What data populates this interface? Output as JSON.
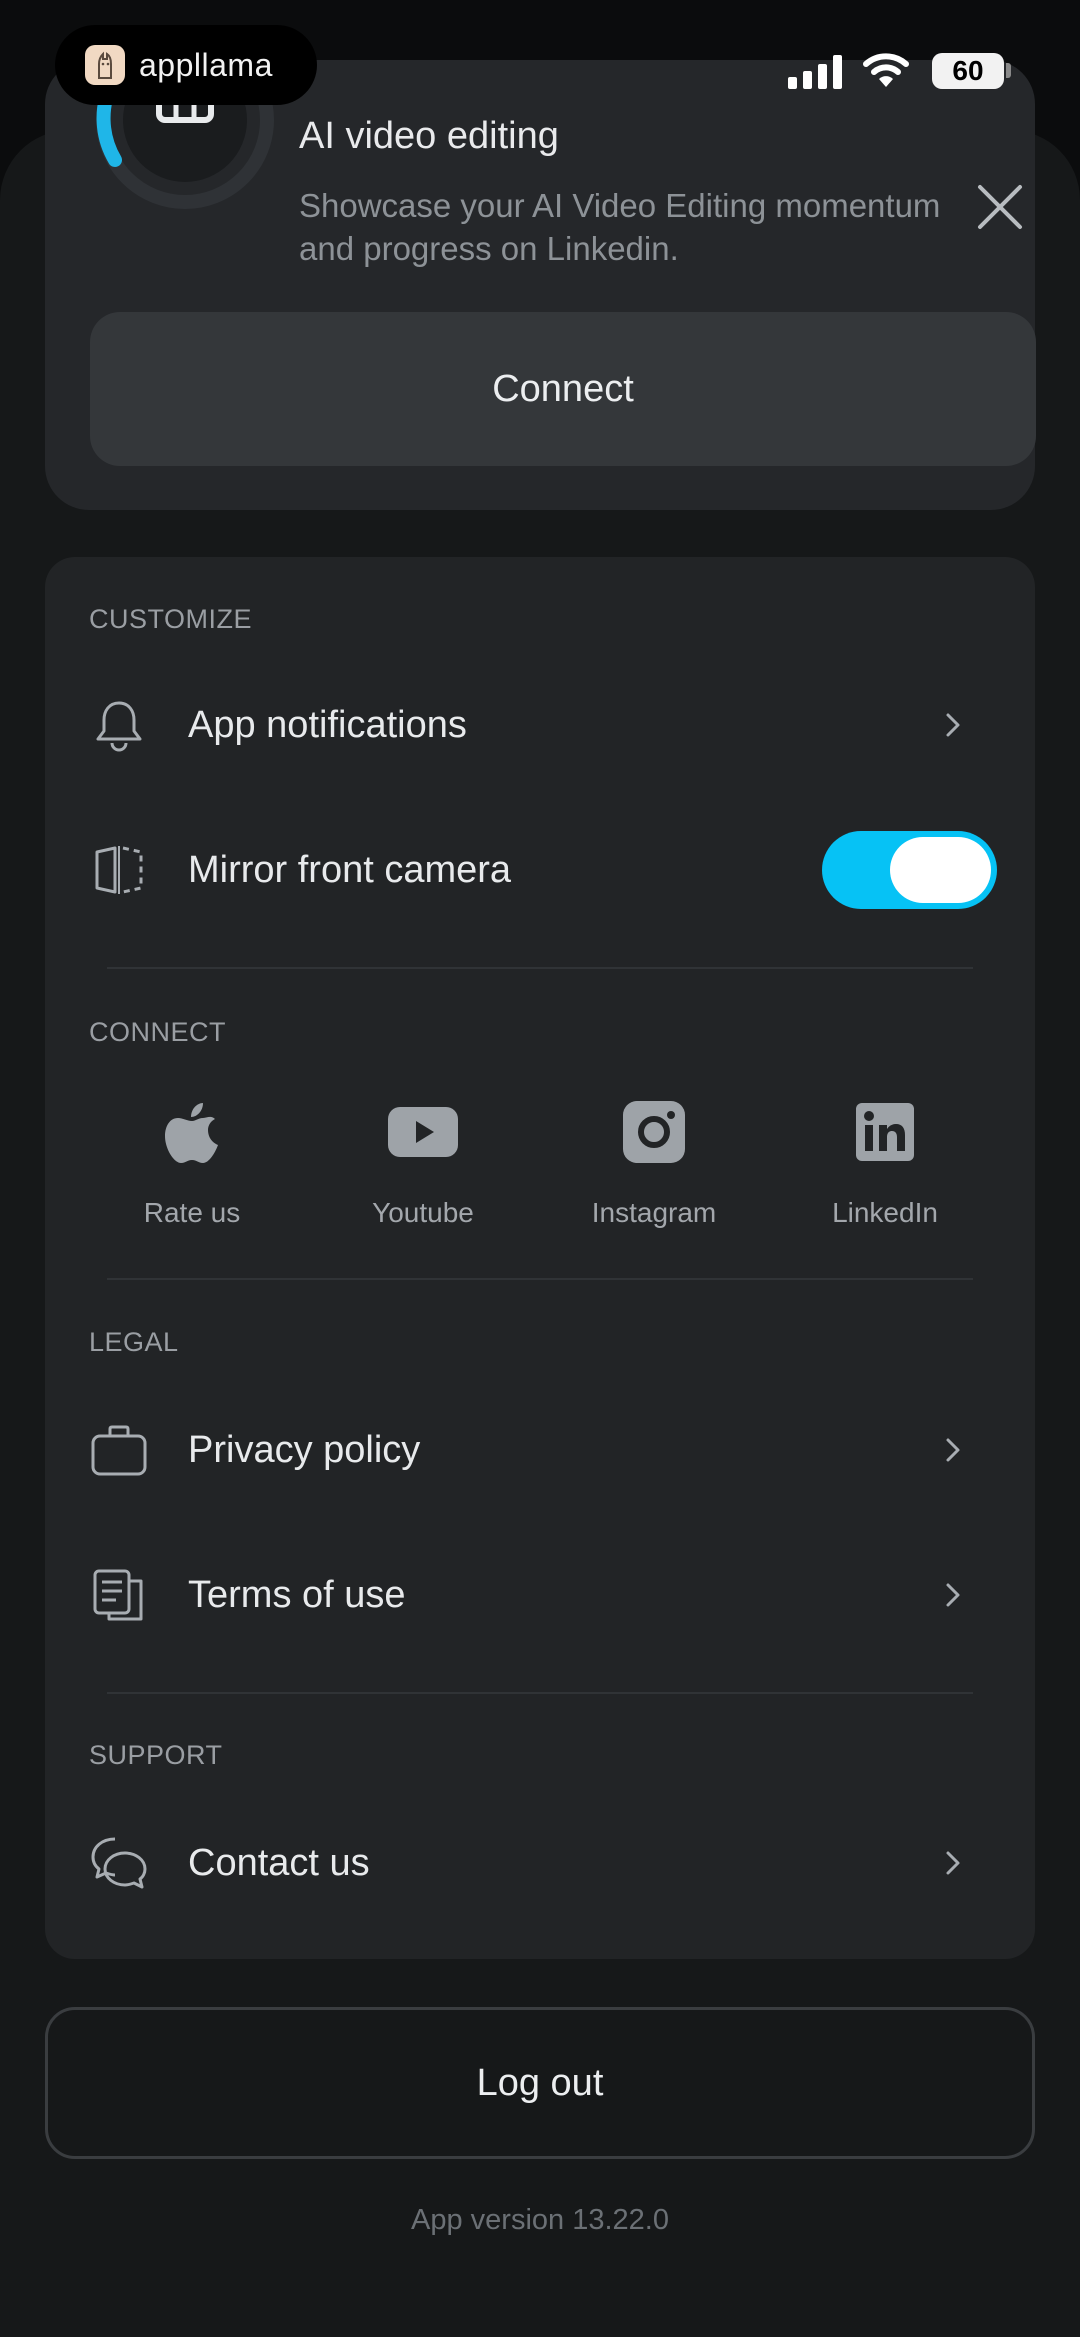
{
  "status_bar": {
    "app_name": "appllama",
    "battery": "60",
    "icons": [
      "app-logo-icon",
      "signal-icon",
      "wifi-icon",
      "battery-icon"
    ]
  },
  "promo": {
    "title": "AI video editing",
    "description": "Showcase your AI Video Editing momentum and progress on Linkedin.",
    "connect_label": "Connect",
    "accent_color": "#1fb6e8"
  },
  "customize": {
    "section_label": "CUSTOMIZE",
    "items": [
      {
        "label": "App notifications",
        "icon": "bell-icon"
      },
      {
        "label": "Mirror front camera",
        "icon": "mirror-icon",
        "toggle_on": true
      }
    ]
  },
  "connect": {
    "section_label": "CONNECT",
    "items": [
      {
        "label": "Rate us",
        "icon": "apple-icon"
      },
      {
        "label": "Youtube",
        "icon": "youtube-icon"
      },
      {
        "label": "Instagram",
        "icon": "instagram-icon"
      },
      {
        "label": "LinkedIn",
        "icon": "linkedin-icon"
      }
    ]
  },
  "legal": {
    "section_label": "LEGAL",
    "items": [
      {
        "label": "Privacy policy",
        "icon": "briefcase-icon"
      },
      {
        "label": "Terms of use",
        "icon": "document-icon"
      }
    ]
  },
  "support": {
    "section_label": "SUPPORT",
    "items": [
      {
        "label": "Contact us",
        "icon": "chat-bubbles-icon"
      }
    ]
  },
  "logout_label": "Log out",
  "app_version": "App version 13.22.0",
  "colors": {
    "background": "#0b0c0d",
    "card": "#222426",
    "toggle_on": "#06c2f5"
  }
}
